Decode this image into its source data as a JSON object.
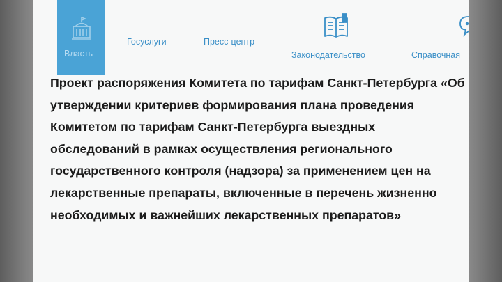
{
  "nav": {
    "items": [
      {
        "label": "Власть",
        "icon": "government-building-icon",
        "active": true
      },
      {
        "label": "Госуслуги",
        "icon": "",
        "active": false
      },
      {
        "label": "Пресс-центр",
        "icon": "",
        "active": false
      },
      {
        "label": "Законодательство",
        "icon": "law-book-icon",
        "active": false
      },
      {
        "label": "Справочная",
        "icon": "speech-bubble-icon",
        "active": false
      }
    ]
  },
  "document": {
    "title": "Проект распоряжения Комитета по тарифам Санкт-Петербурга «Об утверждении критериев формирования плана проведения Комитетом по тарифам Санкт-Петербурга выездных обследований в рамках осуществления регионального государственного контроля (надзора) за применением цен на лекарственные препараты, включенные в перечень жизненно необходимых и важнейших лекарственных препаратов»"
  },
  "colors": {
    "accent": "#4aa3d6",
    "link": "#3a8fc7",
    "text": "#1c1c1c",
    "background": "#f7f8f8"
  }
}
